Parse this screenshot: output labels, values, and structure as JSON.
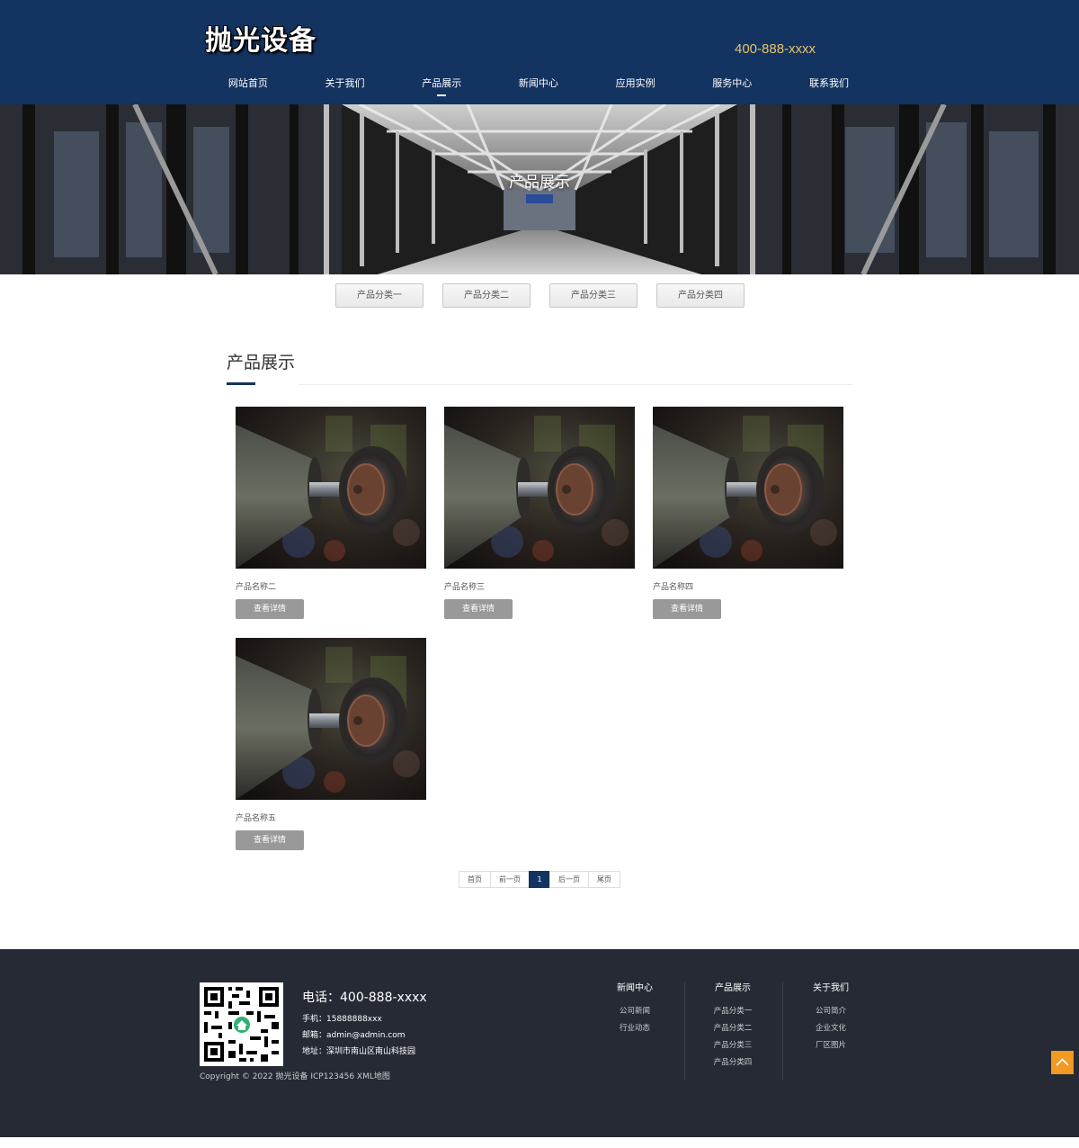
{
  "header": {
    "logo": "抛光设备",
    "hotline": "400-888-xxxx",
    "nav": [
      "网站首页",
      "关于我们",
      "产品展示",
      "新闻中心",
      "应用实例",
      "服务中心",
      "联系我们"
    ],
    "nav_active_index": 2
  },
  "banner": {
    "title": "产品展示"
  },
  "categories": [
    "产品分类一",
    "产品分类二",
    "产品分类三",
    "产品分类四"
  ],
  "section": {
    "title": "产品展示"
  },
  "products": [
    {
      "name": "产品名称二",
      "button": "查看详情"
    },
    {
      "name": "产品名称三",
      "button": "查看详情"
    },
    {
      "name": "产品名称四",
      "button": "查看详情"
    },
    {
      "name": "产品名称五",
      "button": "查看详情"
    }
  ],
  "pagination": {
    "first": "首页",
    "prev": "前一页",
    "current": "1",
    "next": "后一页",
    "last": "尾页"
  },
  "footer": {
    "phone": "电话：400-888-xxxx",
    "mobile": "手机：15888888xxx",
    "email": "邮箱：admin@admin.com",
    "address": "地址：深圳市南山区南山科技园",
    "copyright": "Copyright © 2022 抛光设备   ICP123456   XML地图",
    "columns": [
      {
        "title": "新闻中心",
        "links": [
          "公司新闻",
          "行业动态"
        ]
      },
      {
        "title": "产品展示",
        "links": [
          "产品分类一",
          "产品分类二",
          "产品分类三",
          "产品分类四"
        ]
      },
      {
        "title": "关于我们",
        "links": [
          "公司简介",
          "企业文化",
          "厂区图片"
        ]
      }
    ]
  },
  "colors": {
    "header_bg": "#133360",
    "hotline": "#e8c36a",
    "footer_bg": "#252a35",
    "to_top": "#f39a22",
    "button_gray": "#999999"
  },
  "icons": {
    "back_to_top": "chevron-up-icon",
    "qr_code": "qr-code-icon"
  }
}
